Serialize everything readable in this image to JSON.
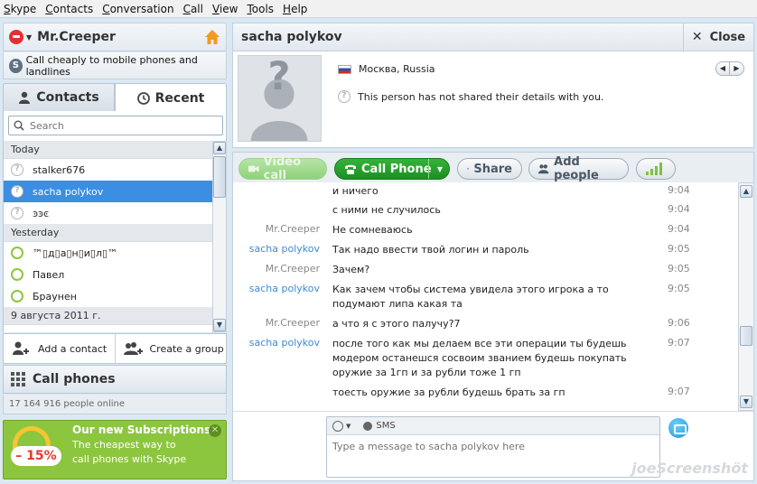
{
  "menu": [
    "Skype",
    "Contacts",
    "Conversation",
    "Call",
    "View",
    "Tools",
    "Help"
  ],
  "profile": {
    "name": "Mr.Creeper"
  },
  "promo_text": "Call cheaply to mobile phones and landlines",
  "tabs": {
    "contacts": "Contacts",
    "recent": "Recent"
  },
  "search": {
    "placeholder": "Search"
  },
  "recent": {
    "groups": [
      {
        "label": "Today"
      },
      {
        "label": "Yesterday"
      },
      {
        "label": "9 августа 2011 г."
      }
    ],
    "today": [
      "stalker676",
      "sacha polykov",
      "ͽͽͼ"
    ],
    "yesterday": [
      "™▯д▯а▯н▯и▯л▯™",
      "Павел",
      "Браунен"
    ]
  },
  "actions": {
    "add_contact": "Add a contact",
    "create_group": "Create a group"
  },
  "call_phones": "Call phones",
  "online_count": "17 164 916 people online",
  "ad": {
    "title": "Our new Subscriptions -",
    "text": "The cheapest way to call phones with Skype",
    "badge": "– 15%"
  },
  "conversation": {
    "title": "sacha polykov",
    "close_label": "Close",
    "location": "Москва, Russia",
    "privacy_note": "This person has not shared their details with you."
  },
  "toolbar": {
    "video_call": "Video call",
    "call_phone": "Call Phone",
    "share": "Share",
    "add_people": "Add people"
  },
  "messages": [
    {
      "sender": "",
      "text": "и ничего",
      "time": "9:04",
      "other": false
    },
    {
      "sender": "",
      "text": "с ними не случилось",
      "time": "9:04",
      "other": false
    },
    {
      "sender": "Mr.Creeper",
      "text": "Не сомневаюсь",
      "time": "9:04",
      "other": false
    },
    {
      "sender": "sacha polykov",
      "text": "Так надо ввести твой логин и пароль",
      "time": "9:05",
      "other": true
    },
    {
      "sender": "Mr.Creeper",
      "text": "Зачем?",
      "time": "9:05",
      "other": false
    },
    {
      "sender": "sacha polykov",
      "text": "Как зачем чтобы система увидела этого игрока а то подумают липа какая та",
      "time": "9:05",
      "other": true
    },
    {
      "sender": "Mr.Creeper",
      "text": "а что я с этого палучу?7",
      "time": "9:06",
      "other": false
    },
    {
      "sender": "sacha polykov",
      "text": "после того как мы делаем все эти операции ты будешь модером останешся сосвоим званием будешь покупать оружие за 1гп и за рубли тоже 1 гп",
      "time": "9:07",
      "other": true
    },
    {
      "sender": "",
      "text": "тоесть оружие за рубли будешь брать за гп",
      "time": "9:07",
      "other": false
    }
  ],
  "compose": {
    "sms_label": "SMS",
    "placeholder": "Type a message to sacha polykov here"
  },
  "watermark": "joeScreenshöt"
}
